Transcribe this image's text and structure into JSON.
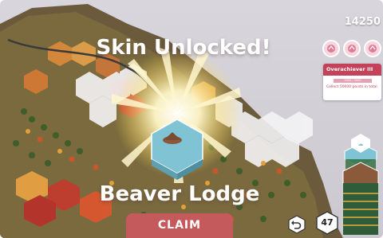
{
  "hud": {
    "score": "14250",
    "achievement_icons": [
      "pink-badge-icon",
      "pink-badge-icon",
      "pink-badge-icon"
    ],
    "achievement": {
      "title": "Overachiever III",
      "progress": "5000 / 5000",
      "progress_fraction": 1.0,
      "description": "Collect 50000 points in total."
    },
    "tiles_remaining": "47",
    "undo_icon": "undo-arrow-icon"
  },
  "unlock": {
    "headline": "Skin Unlocked!",
    "item_name": "Beaver Lodge",
    "claim_label": "CLAIM"
  },
  "colors": {
    "accent": "#c45a5c",
    "card_header": "#c4415a",
    "background": "#d4d2d8",
    "water": "#7fc3d4"
  }
}
